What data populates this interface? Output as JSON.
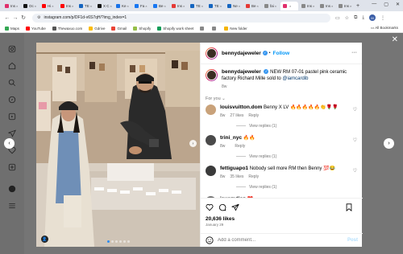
{
  "browser": {
    "tabs": [
      {
        "label": "Ins",
        "fav": "#e1306c"
      },
      {
        "label": "Oc",
        "fav": "#111"
      },
      {
        "label": "Hi",
        "fav": "#ff0000"
      },
      {
        "label": "Ins",
        "fav": "#ff0000"
      },
      {
        "label": "TE",
        "fav": "#1565c0"
      },
      {
        "label": "X C",
        "fav": "#111"
      },
      {
        "label": "Ke",
        "fav": "#1a73e8"
      },
      {
        "label": "Fa",
        "fav": "#1877f2"
      },
      {
        "label": "Be",
        "fav": "#1877f2"
      },
      {
        "label": "Ins",
        "fav": "#e53935"
      },
      {
        "label": "TE",
        "fav": "#1565c0"
      },
      {
        "label": "TE",
        "fav": "#1565c0"
      },
      {
        "label": "Ne",
        "fav": "#1565c0"
      },
      {
        "label": "Be",
        "fav": "#e53935"
      },
      {
        "label": "fai",
        "fav": "#888"
      },
      {
        "label": "",
        "fav": "#e1306c",
        "active": true
      },
      {
        "label": "Ins",
        "fav": "#888"
      },
      {
        "label": "Ins",
        "fav": "#888"
      },
      {
        "label": "Ins",
        "fav": "#888"
      }
    ],
    "new_tab": "+",
    "url": "instagram.com/p/DF1d-v6S7qH/?img_index=1",
    "profile_initial": "M",
    "bookmarks": [
      {
        "label": "Maps",
        "fav": "#34a853"
      },
      {
        "label": "YouTube",
        "fav": "#ff0000"
      },
      {
        "label": "Thewaxuo.com",
        "fav": "#555"
      },
      {
        "label": "Gdrive",
        "fav": "#fbbc05"
      },
      {
        "label": "Gmail",
        "fav": "#ea4335"
      },
      {
        "label": "Shopify",
        "fav": "#95bf47"
      },
      {
        "label": "Shopify work sheet",
        "fav": "#0f9d58"
      },
      {
        "label": "",
        "fav": "#888"
      },
      {
        "label": "",
        "fav": "#888"
      },
      {
        "label": "New folder",
        "fav": "#f4b400"
      }
    ],
    "all_bookmarks": "All Bookmarks"
  },
  "post": {
    "username": "bennydajeweler",
    "follow_label": "Follow",
    "caption_text": "NEW RM 07-01 pastel pink ceramic factory Richard Mille sold to ",
    "caption_mention": "@iamcardib",
    "caption_age": "8w",
    "for_you": "For you",
    "comments": [
      {
        "user": "louisvuitton.dom",
        "text": "Benny X LV 🔥🔥🔥🔥🔥👏🌹🌹",
        "age": "8w",
        "likes": "27 likes",
        "reply": "Reply",
        "view": "View replies (1)",
        "avatar": "#c9a27a"
      },
      {
        "user": "trini_nyc",
        "text": "🔥🔥",
        "age": "8w",
        "likes": "",
        "reply": "Reply",
        "view": "View replies (1)",
        "avatar": "#4a4a4a"
      },
      {
        "user": "fettiguapo1",
        "text": "Nobody sell more RM then Benny 💯😂",
        "age": "8w",
        "likes": "35 likes",
        "reply": "Reply",
        "view": "View replies (1)",
        "avatar": "#3a3a3a"
      },
      {
        "user": "isuamdian",
        "text": "❤️",
        "age": "",
        "likes": "",
        "reply": "",
        "view": "",
        "avatar": "#777"
      }
    ],
    "likes": "20,636 likes",
    "date": "January 29",
    "add_comment_placeholder": "Add a comment...",
    "post_button": "Post",
    "carousel_count": 6,
    "carousel_active": 1
  },
  "icons": {
    "sidebar": [
      "instagram-logo-icon",
      "home-icon",
      "search-icon",
      "explore-icon",
      "reels-icon",
      "messages-icon",
      "notifications-icon",
      "create-icon",
      "profile-icon",
      "menu-icon"
    ]
  }
}
